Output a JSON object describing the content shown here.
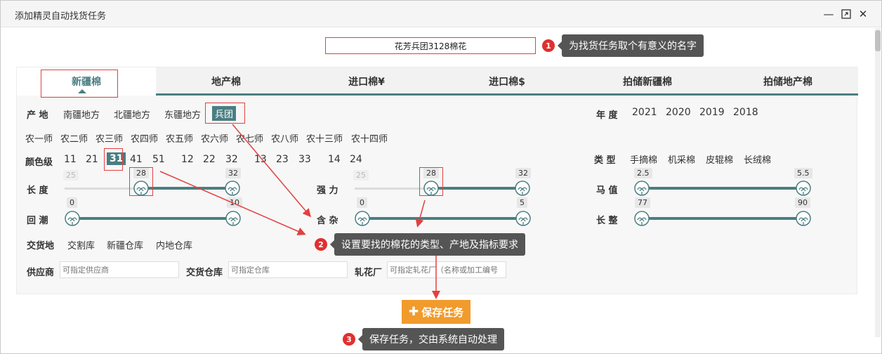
{
  "window": {
    "title": "添加精灵自动找货任务"
  },
  "task_name": {
    "value": "花芳兵团3128棉花"
  },
  "callouts": [
    {
      "num": "1",
      "text": "为找货任务取个有意义的名字"
    },
    {
      "num": "2",
      "text": "设置要找的棉花的类型、产地及指标要求"
    },
    {
      "num": "3",
      "text": "保存任务，交由系统自动处理"
    }
  ],
  "tabs": [
    {
      "label": "新疆棉",
      "active": true
    },
    {
      "label": "地产棉"
    },
    {
      "label": "进口棉¥"
    },
    {
      "label": "进口棉$"
    },
    {
      "label": "拍储新疆棉"
    },
    {
      "label": "拍储地产棉"
    }
  ],
  "origin": {
    "label": "产  地",
    "options": [
      "南疆地方",
      "北疆地方",
      "东疆地方",
      "兵团"
    ],
    "selected": "兵团",
    "divisions": [
      "农一师",
      "农二师",
      "农三师",
      "农四师",
      "农五师",
      "农六师",
      "农七师",
      "农八师",
      "农十三师",
      "农十四师"
    ]
  },
  "year": {
    "label": "年  度",
    "options": [
      "2021",
      "2020",
      "2019",
      "2018"
    ]
  },
  "color_grade": {
    "label": "颜色级",
    "options": [
      "11",
      "21",
      "31",
      "41",
      "51",
      "12",
      "22",
      "32",
      "13",
      "23",
      "33",
      "14",
      "24"
    ],
    "selected": "31"
  },
  "type": {
    "label": "类  型",
    "options": [
      "手摘棉",
      "机采棉",
      "皮辊棉",
      "长绒棉"
    ]
  },
  "sliders": {
    "length": {
      "label": "长  度",
      "min": "25",
      "low": "28",
      "high": "32"
    },
    "strength": {
      "label": "强  力",
      "min": "25",
      "low": "28",
      "high": "32"
    },
    "micronaire": {
      "label": "马  值",
      "low": "2.5",
      "high": "5.5"
    },
    "moisture": {
      "label": "回  潮",
      "low": "0",
      "high": "10"
    },
    "trash": {
      "label": "含  杂",
      "low": "0",
      "high": "5"
    },
    "uniformity": {
      "label": "长  整",
      "low": "77",
      "high": "90"
    }
  },
  "delivery": {
    "label": "交货地",
    "options": [
      "交割库",
      "新疆仓库",
      "内地仓库"
    ]
  },
  "fields": {
    "supplier": {
      "label": "供应商",
      "placeholder": "可指定供应商"
    },
    "warehouse": {
      "label": "交货仓库",
      "placeholder": "可指定仓库"
    },
    "gin": {
      "label": "轧花厂",
      "placeholder": "可指定轧花厂（名称或加工编号"
    }
  },
  "save_button": {
    "label": "保存任务",
    "icon": "plus-icon"
  },
  "colors": {
    "accent": "#4a7e82",
    "highlight": "#e34040",
    "save": "#f19b2c",
    "callout": "#555555"
  }
}
